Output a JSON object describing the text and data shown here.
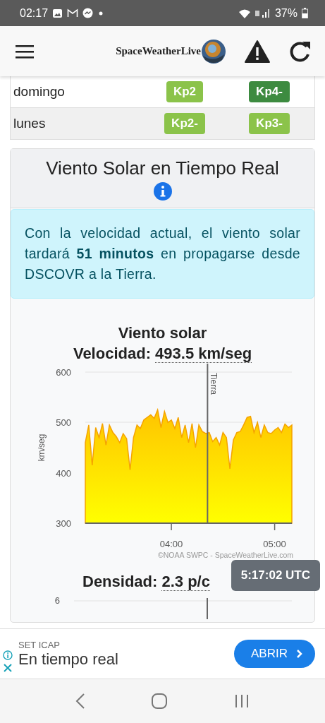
{
  "status_bar": {
    "time": "02:17",
    "battery": "37%"
  },
  "header": {
    "logo": "SpaceWeatherLive"
  },
  "kp_table": {
    "rows": [
      {
        "day": "domingo",
        "values": [
          {
            "label": "Kp2",
            "color": "#8bc34a"
          },
          {
            "label": "Kp4-",
            "color": "#3d8b40"
          }
        ]
      },
      {
        "day": "lunes",
        "values": [
          {
            "label": "Kp2-",
            "color": "#8bc34a"
          },
          {
            "label": "Kp3-",
            "color": "#8bc34a"
          }
        ]
      }
    ]
  },
  "solar_wind": {
    "title": "Viento Solar en Tiempo Real",
    "alert": "Con la velocidad actual, el viento solar tardará **51 minutos** en propagarse desde DSCOVR a la Tierra.",
    "chart_title": "Viento solar",
    "speed_label": "Velocidad:",
    "speed_value": "493.5 km/seg",
    "chart_data": {
      "type": "area",
      "ylabel": "km/seg",
      "ylim": [
        300,
        600
      ],
      "yticks": [
        300,
        400,
        500,
        600
      ],
      "categories": [
        null,
        null,
        null,
        null,
        null,
        null,
        null,
        null,
        null,
        null,
        null,
        null,
        null,
        null,
        null,
        null,
        null,
        null,
        null,
        null,
        null,
        null,
        null,
        null,
        null,
        "04:00",
        null,
        null,
        null,
        null,
        null,
        null,
        null,
        null,
        null,
        null,
        null,
        null,
        null,
        null,
        null,
        null,
        null,
        null,
        null,
        null,
        null,
        null,
        null,
        null,
        null,
        null,
        null,
        null,
        null,
        "05:00",
        null,
        null,
        null,
        null,
        null
      ],
      "series": [
        {
          "color": "#f5a300",
          "values": [
            460,
            495,
            415,
            490,
            470,
            498,
            455,
            495,
            480,
            472,
            460,
            478,
            468,
            406,
            470,
            495,
            488,
            505,
            510,
            515,
            508,
            525,
            490,
            522,
            500,
            505,
            488,
            510,
            470,
            495,
            460,
            498,
            450,
            495,
            482,
            478,
            480,
            462,
            470,
            455,
            480,
            470,
            408,
            465,
            480,
            482,
            495,
            510,
            512,
            480,
            500,
            470,
            495,
            480,
            478,
            485,
            490,
            480,
            497,
            490,
            495
          ]
        }
      ]
    },
    "earth_marker": "Tierra",
    "credit": "©NOAA SWPC - SpaceWeatherLive.com",
    "density_label": "Densidad:",
    "density_value": "2.3 p/c",
    "density_chart_tick": "6",
    "tooltip": "5:17:02 UTC"
  },
  "ad": {
    "advertiser": "SET ICAP",
    "headline": "En tiempo real",
    "button": "ABRIR"
  }
}
